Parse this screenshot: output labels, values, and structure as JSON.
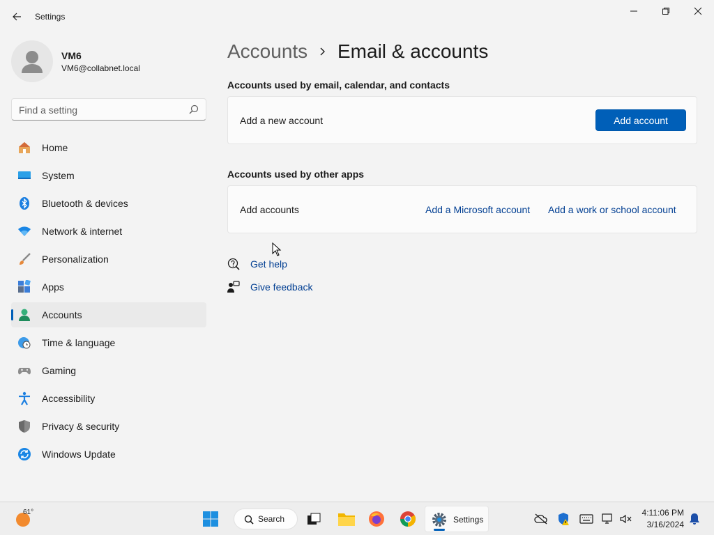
{
  "window": {
    "title": "Settings",
    "back_icon": "back-arrow-icon",
    "controls": [
      "minimize-icon",
      "maximize-icon",
      "close-icon"
    ]
  },
  "profile": {
    "name": "VM6",
    "email": "VM6@collabnet.local"
  },
  "search": {
    "placeholder": "Find a setting"
  },
  "sidebar": {
    "items": [
      {
        "label": "Home",
        "icon": "home-icon"
      },
      {
        "label": "System",
        "icon": "system-icon"
      },
      {
        "label": "Bluetooth & devices",
        "icon": "bluetooth-icon"
      },
      {
        "label": "Network & internet",
        "icon": "wifi-icon"
      },
      {
        "label": "Personalization",
        "icon": "brush-icon"
      },
      {
        "label": "Apps",
        "icon": "apps-icon"
      },
      {
        "label": "Accounts",
        "icon": "accounts-icon",
        "selected": true
      },
      {
        "label": "Time & language",
        "icon": "globe-clock-icon"
      },
      {
        "label": "Gaming",
        "icon": "gamepad-icon"
      },
      {
        "label": "Accessibility",
        "icon": "accessibility-icon"
      },
      {
        "label": "Privacy & security",
        "icon": "shield-icon"
      },
      {
        "label": "Windows Update",
        "icon": "update-icon"
      }
    ]
  },
  "breadcrumb": {
    "parent": "Accounts",
    "current": "Email & accounts"
  },
  "sections": {
    "email": {
      "title": "Accounts used by email, calendar, and contacts",
      "row_label": "Add a new account",
      "button_label": "Add account"
    },
    "other": {
      "title": "Accounts used by other apps",
      "row_label": "Add accounts",
      "link_microsoft": "Add a Microsoft account",
      "link_work": "Add a work or school account"
    }
  },
  "help": {
    "get_help": "Get help",
    "give_feedback": "Give feedback"
  },
  "taskbar": {
    "weather_temp": "61°",
    "search_label": "Search",
    "settings_label": "Settings",
    "time": "4:11:06 PM",
    "date": "3/16/2024"
  },
  "colors": {
    "accent": "#005fb8",
    "link": "#003e92",
    "background": "#f3f3f3",
    "card": "#fbfbfb"
  }
}
